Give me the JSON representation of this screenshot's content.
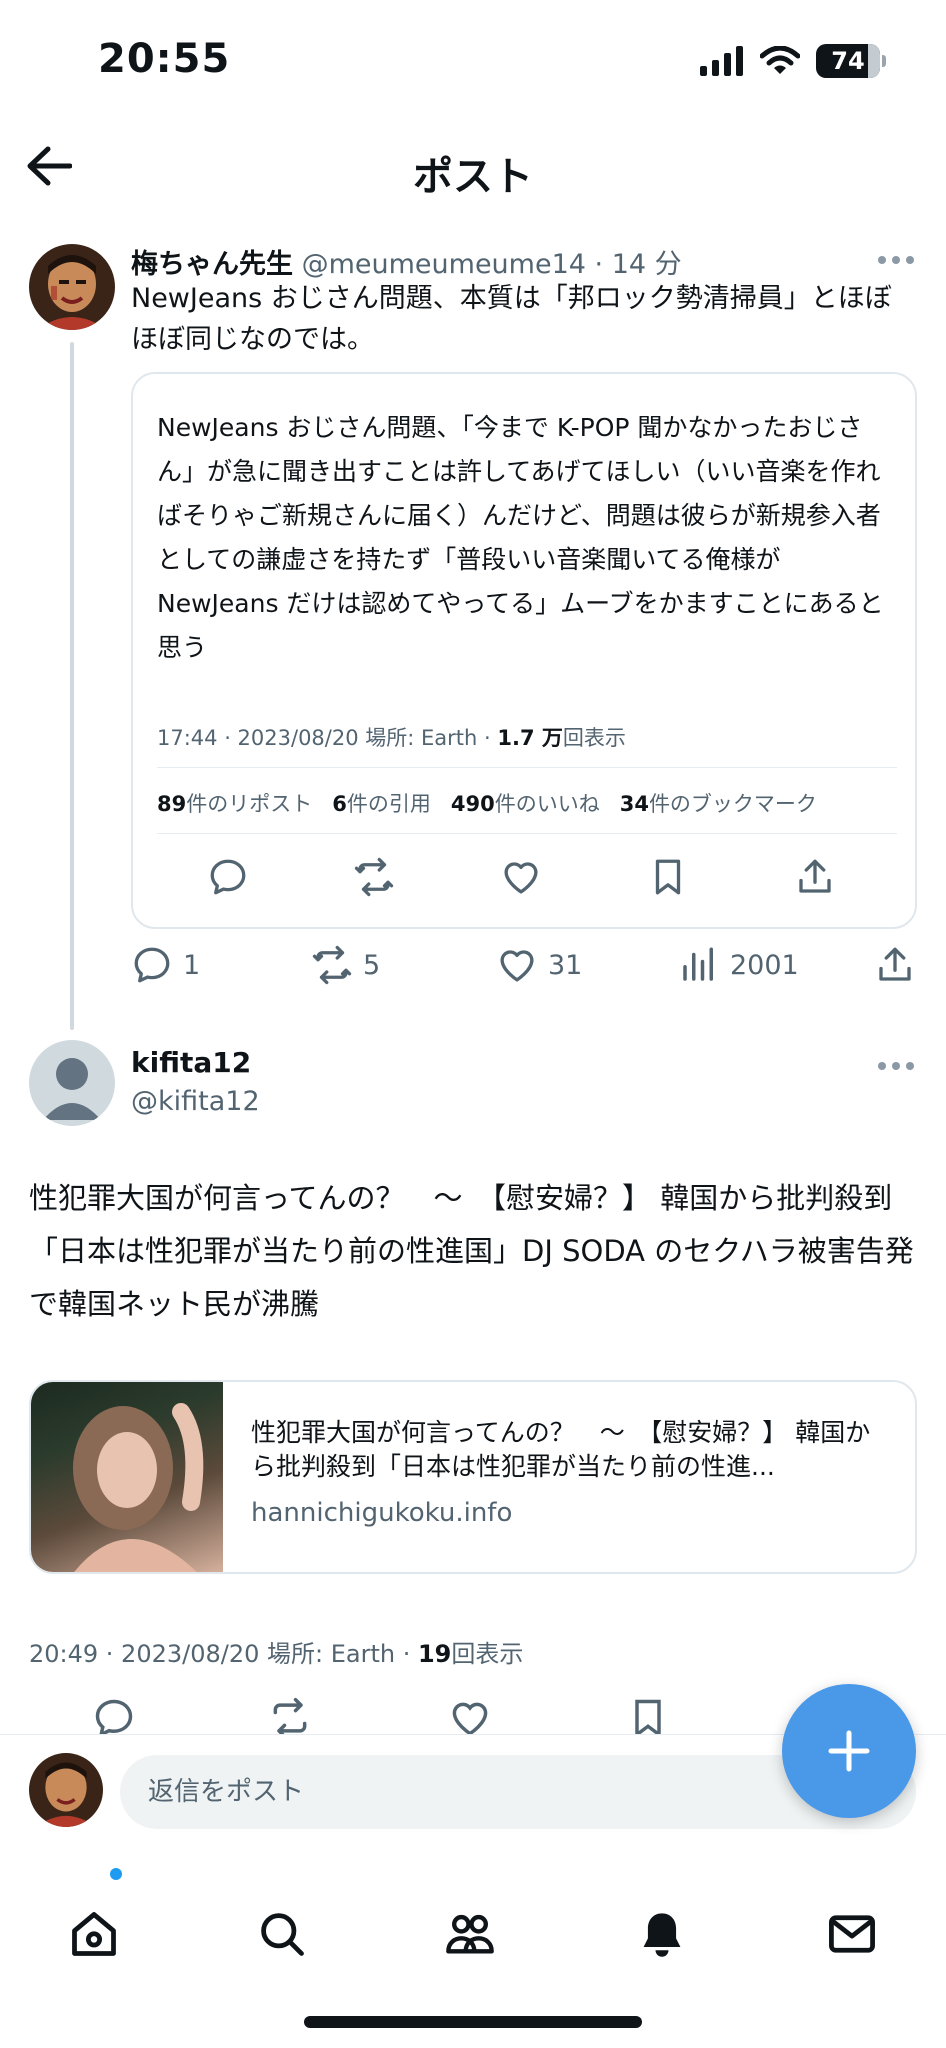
{
  "status_bar": {
    "time": "20:55",
    "battery": "74"
  },
  "header": {
    "title": "ポスト"
  },
  "main_post": {
    "author": "梅ちゃん先生",
    "handle": "@meumeumeume14",
    "separator": "·",
    "time_ago": "14 分",
    "text": "NewJeans おじさん問題、本質は「邦ロック勢清掃員」とほぼほぼ同じなのでは。",
    "quote": {
      "text": "NewJeans おじさん問題、「今まで K-POP 聞かなかったおじさん」が急に聞き出すことは許してあげてほしい（いい音楽を作ればそりゃご新規さんに届く）んだけど、問題は彼らが新規参入者としての謙虚さを持たず「普段いい音楽聞いてる俺様が NewJeans だけは認めてやってる」ムーブをかますことにあると思う",
      "meta_prefix": "17:44 · 2023/08/20 場所: Earth · ",
      "views_count": "1.7 万",
      "views_label": "回表示",
      "stats": {
        "reposts_count": "89",
        "reposts_label": "件のリポスト",
        "quotes_count": "6",
        "quotes_label": "件の引用",
        "likes_count": "490",
        "likes_label": "件のいいね",
        "bookmarks_count": "34",
        "bookmarks_label": "件のブックマーク"
      }
    },
    "actions": {
      "replies": "1",
      "reposts": "5",
      "likes": "31",
      "views": "2001"
    }
  },
  "reply_post": {
    "author": "kifita12",
    "handle": "@kifita12",
    "text": "性犯罪大国が何言ってんの？　～　【慰安婦？】 韓国から批判殺到「日本は性犯罪が当たり前の性進国」DJ SODA のセクハラ被害告発で韓国ネット民が沸騰",
    "link_card": {
      "title": "性犯罪大国が何言ってんの？　～　【慰安婦？】 韓国から批判殺到「日本は性犯罪が当たり前の性進...",
      "domain": "hannichigukoku.info"
    },
    "meta_prefix": "20:49 · 2023/08/20 場所: Earth · ",
    "views_count": "19",
    "views_label": "回表示"
  },
  "compose": {
    "placeholder": "返信をポスト"
  },
  "icons": {
    "back": "arrow-left-icon",
    "more": "more-dots-icon",
    "reply": "speech-bubble-icon",
    "repost": "repost-arrows-icon",
    "like": "heart-icon",
    "bookmark": "bookmark-icon",
    "share": "share-icon",
    "views": "bar-chart-icon",
    "fab": "plus-icon",
    "tabs": [
      "home-icon",
      "search-icon",
      "communities-icon",
      "bell-icon",
      "mail-icon"
    ]
  },
  "colors": {
    "accent": "#1d9bf0",
    "fab": "#4a99e9",
    "muted": "#536471",
    "border": "#e1e8ed"
  }
}
